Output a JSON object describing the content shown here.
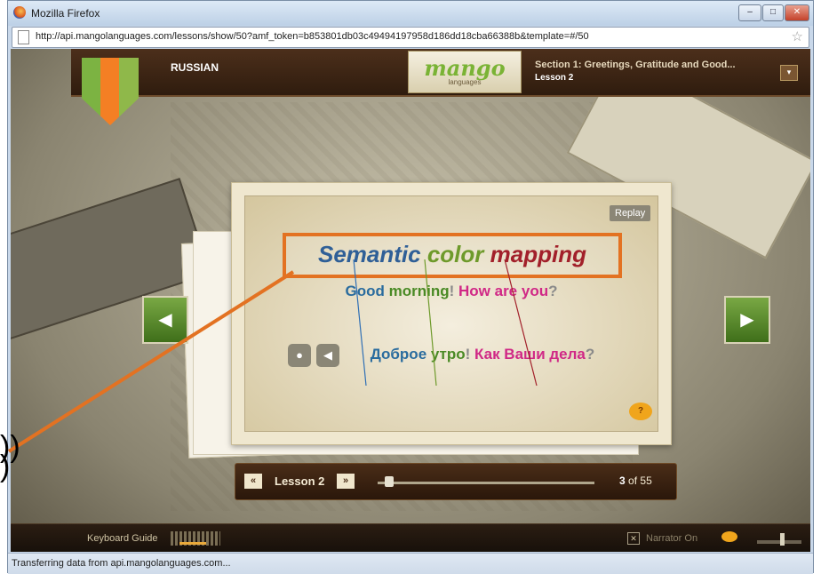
{
  "window": {
    "title": "Mozilla Firefox",
    "minimize": "–",
    "maximize": "□",
    "close": "✕"
  },
  "browser": {
    "url": "http://api.mangolanguages.com/lessons/show/50?amf_token=b853801db03c49494197958d186dd18cba66388b&template=#/50",
    "status": "Transferring data from api.mangolanguages.com..."
  },
  "app": {
    "language": "RUSSIAN",
    "logo_text": "mango",
    "logo_sub": "languages",
    "section_title": "Section 1: Greetings, Gratitude and Good...",
    "section_lesson": "Lesson 2",
    "dropdown_icon": "▾"
  },
  "card": {
    "replay_label": "Replay",
    "english": [
      {
        "text": "Good",
        "color": "#2a6c9e"
      },
      {
        "text": " morning",
        "color": "#4a8a25"
      },
      {
        "text": "!",
        "color": "#8a8a8a"
      },
      {
        "text": " How are you",
        "color": "#d02886"
      },
      {
        "text": "?",
        "color": "#8a8a8a"
      }
    ],
    "russian": [
      {
        "text": "Доброе",
        "color": "#2a6c9e"
      },
      {
        "text": " утро",
        "color": "#4a8a25"
      },
      {
        "text": "!",
        "color": "#8a8a8a"
      },
      {
        "text": " Как Ваши дела",
        "color": "#d02886"
      },
      {
        "text": "?",
        "color": "#8a8a8a"
      }
    ],
    "help_icon": "?"
  },
  "nav": {
    "prev": "◀",
    "next": "▶"
  },
  "lessonbar": {
    "prev": "«",
    "next": "»",
    "lesson": "Lesson 2",
    "current": "3",
    "of_label": "of",
    "total": "55"
  },
  "bottombar": {
    "keyboard_guide": "Keyboard Guide",
    "narrator_checkbox": "✕",
    "narrator_label": "Narrator On"
  },
  "annotation": {
    "word1": "Semantic",
    "word2": "color",
    "word3": "mapping",
    "colors": {
      "blue": "#2f5f97",
      "green": "#6e9a2b",
      "red": "#a2202a",
      "arrow": "#e37222"
    }
  },
  "edge_glyphs": [
    "))",
    ")"
  ]
}
